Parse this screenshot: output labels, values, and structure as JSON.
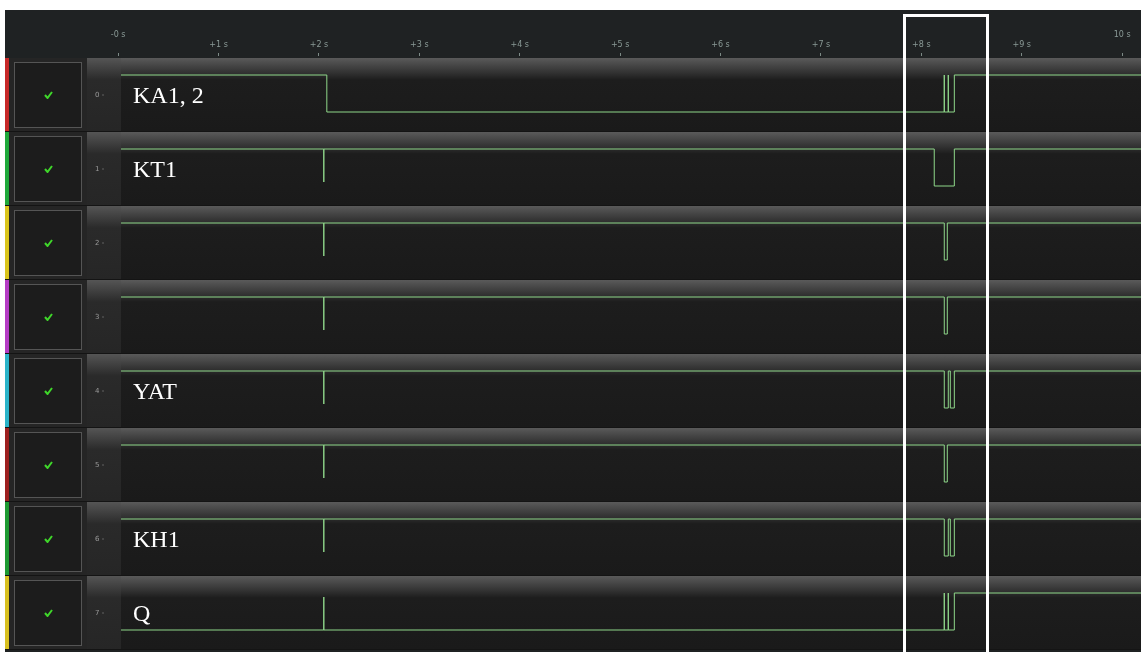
{
  "ruler": {
    "ticks": [
      "-0 s",
      "+1 s",
      "+2 s",
      "+3 s",
      "+4 s",
      "+5 s",
      "+6 s",
      "+7 s",
      "+8 s",
      "+9 s",
      "10 s"
    ]
  },
  "channels": [
    {
      "label": "0 -",
      "color": "#c62828",
      "checked": true,
      "annotation": "KA1, 2"
    },
    {
      "label": "1 -",
      "color": "#1fa83a",
      "checked": true,
      "annotation": "KT1"
    },
    {
      "label": "2 -",
      "color": "#d9c41c",
      "checked": true
    },
    {
      "label": "3 -",
      "color": "#b43bc4",
      "checked": true
    },
    {
      "label": "4 -",
      "color": "#2ab3c9",
      "checked": true,
      "annotation": "YAT"
    },
    {
      "label": "5 -",
      "color": "#9c2020",
      "checked": true
    },
    {
      "label": "6 -",
      "color": "#1e9a32",
      "checked": true,
      "annotation": "KH1"
    },
    {
      "label": "7 -",
      "color": "#d8c020",
      "checked": true,
      "annotation": "Q"
    }
  ]
}
